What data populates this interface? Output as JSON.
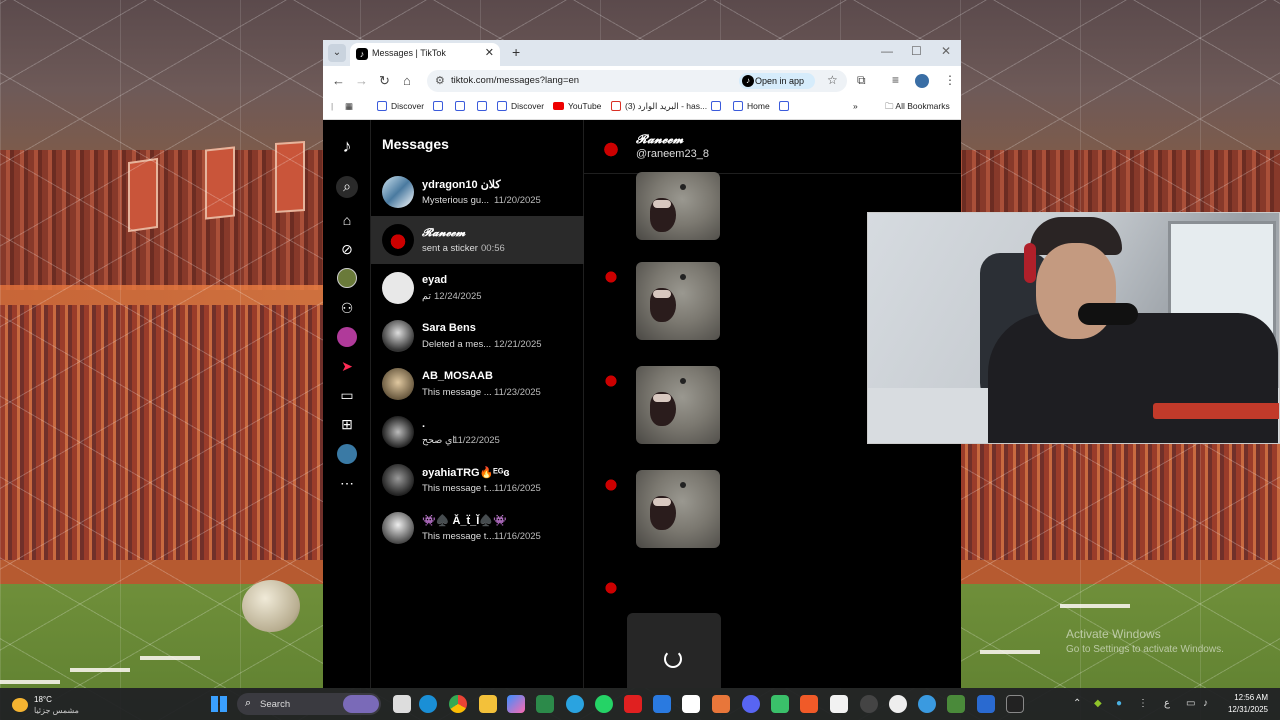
{
  "browser": {
    "tab_title": "Messages | TikTok",
    "url": "tiktok.com/messages?lang=en",
    "open_in_app": "Open in app",
    "bookmarks": [
      "Discover",
      "Discover",
      "YouTube",
      "(3) البريد الوارد - has...",
      "Home"
    ],
    "all_bookmarks": "All Bookmarks"
  },
  "messages": {
    "heading": "Messages",
    "conversations": [
      {
        "name": "ydragon10 كلان",
        "preview": "Mysterious gu...",
        "time": "11/20/2025"
      },
      {
        "name": "𝓡𝓪𝓷𝓮𝓮𝓶",
        "preview": "sent a sticker",
        "time": "00:56"
      },
      {
        "name": "eyad",
        "preview": "تم",
        "time": "12/24/2025"
      },
      {
        "name": "Sara Bens",
        "preview": "Deleted a mes...",
        "time": "12/21/2025"
      },
      {
        "name": "AB_MOSAAB",
        "preview": "This message ...",
        "time": "11/23/2025"
      },
      {
        "name": ".",
        "preview": "اي صحح",
        "time": "11/22/2025"
      },
      {
        "name": "ʚyahiaTRG🔥ᴱᴳɞ",
        "preview": "This message t...",
        "time": "11/16/2025"
      },
      {
        "name": "👾♠️ Ă_ẗ_Ĭ♠️👾",
        "preview": "This message t...",
        "time": "11/16/2025"
      }
    ]
  },
  "chat": {
    "name": "𝓡𝓪𝓷𝓮𝓮𝓶",
    "handle": "@raneem23_8"
  },
  "desktop": {
    "activate_title": "Activate Windows",
    "activate_sub": "Go to Settings to activate Windows."
  },
  "taskbar": {
    "temp": "18°C",
    "weather_text": "مشمس جزئيا",
    "search": "Search",
    "lang": "ع",
    "time": "12:56 AM",
    "date": "12/31/2025"
  },
  "colors": {
    "tiktok_bg": "#000000",
    "active_row": "#2a2a2a",
    "browser_chrome": "#dfe6ee"
  }
}
